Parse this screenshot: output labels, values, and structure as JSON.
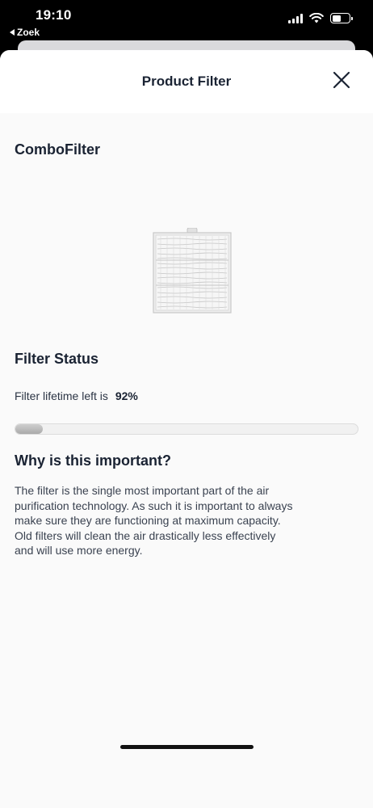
{
  "status_bar": {
    "time": "19:10",
    "back_label": "Zoek",
    "icons": [
      "signal-icon",
      "wifi-icon",
      "battery-icon"
    ]
  },
  "header": {
    "title": "Product Filter",
    "close_icon": "close-icon"
  },
  "product": {
    "name": "ComboFilter",
    "image_icon": "filter-image"
  },
  "filter_status": {
    "title": "Filter Status",
    "lifetime_label": "Filter lifetime left is",
    "lifetime_value": "92%",
    "lifetime_fraction": 0.92
  },
  "importance": {
    "title": "Why is this important?",
    "text": "The filter is the single most important part of the air purification technology. As such it is important to always make sure they are functioning at maximum capacity. Old filters will clean the air drastically less effectively and will use more energy."
  },
  "colors": {
    "heading": "#1a2333",
    "sheet_background": "#fafafa",
    "header_background": "#ffffff",
    "progress_used": "#b5b5b5"
  }
}
